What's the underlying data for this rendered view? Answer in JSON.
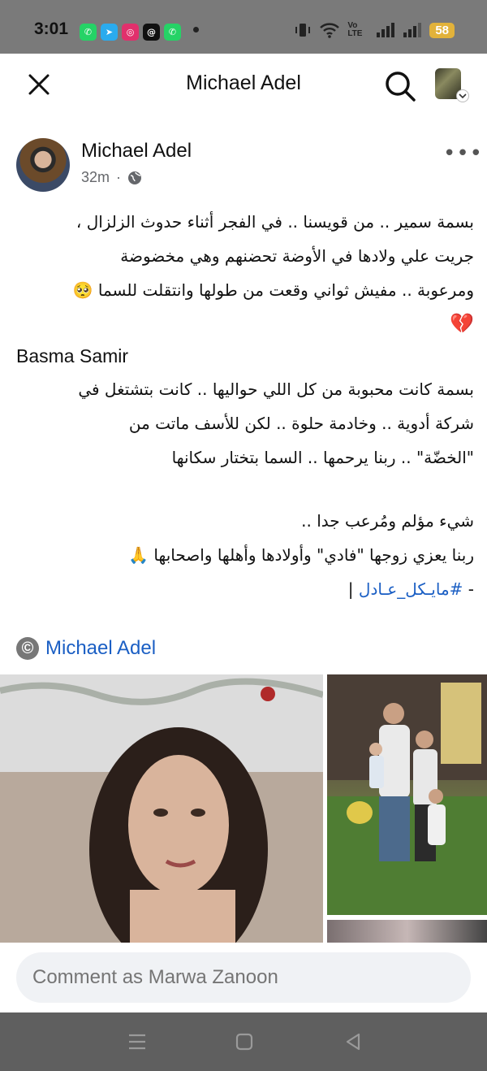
{
  "status_bar": {
    "time": "3:01",
    "apps": [
      {
        "name": "whatsapp-icon",
        "color": "#25D366",
        "glyph": "✆"
      },
      {
        "name": "telegram-icon",
        "color": "#2AABEE",
        "glyph": "➤"
      },
      {
        "name": "instagram-icon",
        "color": "#E1306C",
        "glyph": "◎"
      },
      {
        "name": "threads-icon",
        "color": "#111111",
        "glyph": "@"
      },
      {
        "name": "whatsapp-icon",
        "color": "#25D366",
        "glyph": "✆"
      }
    ],
    "network_label": "Vo LTE",
    "battery": "58"
  },
  "top_bar": {
    "title": "Michael Adel"
  },
  "post": {
    "author": "Michael Adel",
    "time": "32m",
    "body": {
      "p1": [
        "بسمة سمير .. من قويسنا .. في الفجر أثناء حدوث الزلزال ،",
        "جريت علي ولادها في الأوضة تحضنهم وهي مخضوضة",
        "ومرعوبة .. مفيش ثواني وقعت من طولها وانتقلت للسما 🥺",
        "💔"
      ],
      "name_en": "Basma Samir",
      "p2": [
        "بسمة كانت محبوبة من كل اللي حواليها .. كانت بتشتغل في",
        "شركة أدوية .. وخادمة حلوة .. لكن للأسف ماتت من",
        "\"الخضّة\" .. ربنا يرحمها .. السما بتختار سكانها"
      ],
      "p3": [
        "شيء مؤلم ومُرعب جدا ..",
        "ربنا يعزي زوجها \"فادي\" وأولادها وأهلها واصحابها 🙏"
      ],
      "hashtag_prefix": "- ",
      "hashtag": "#مايـكل_عـادل",
      "hashtag_suffix": " |"
    },
    "copyright_symbol": "©",
    "copyright_name": "Michael Adel"
  },
  "comment": {
    "placeholder": "Comment as Marwa Zanoon"
  },
  "nav": {
    "menu_glyph": "☰",
    "home_glyph": "▢",
    "back_glyph": "◁"
  }
}
